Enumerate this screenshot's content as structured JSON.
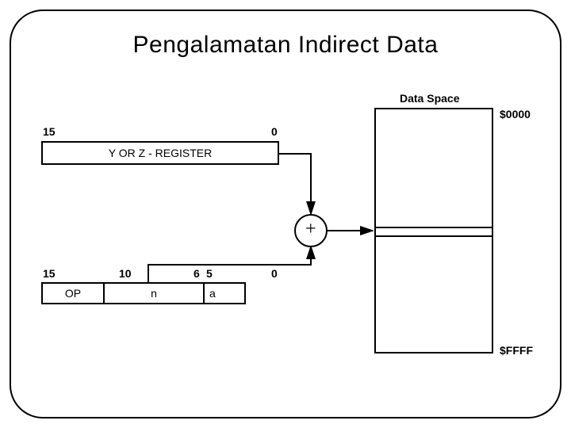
{
  "title": "Pengalamatan Indirect Data",
  "dataSpace": {
    "header": "Data Space",
    "start": "$0000",
    "end": "$FFFF"
  },
  "register": {
    "label": "Y OR Z - REGISTER",
    "msb": "15",
    "lsb": "0"
  },
  "instruction": {
    "b15": "15",
    "b10": "10",
    "b6": "6",
    "b5": "5",
    "b0": "0",
    "op": "OP",
    "n": "n",
    "a": "a"
  },
  "adder": "+"
}
